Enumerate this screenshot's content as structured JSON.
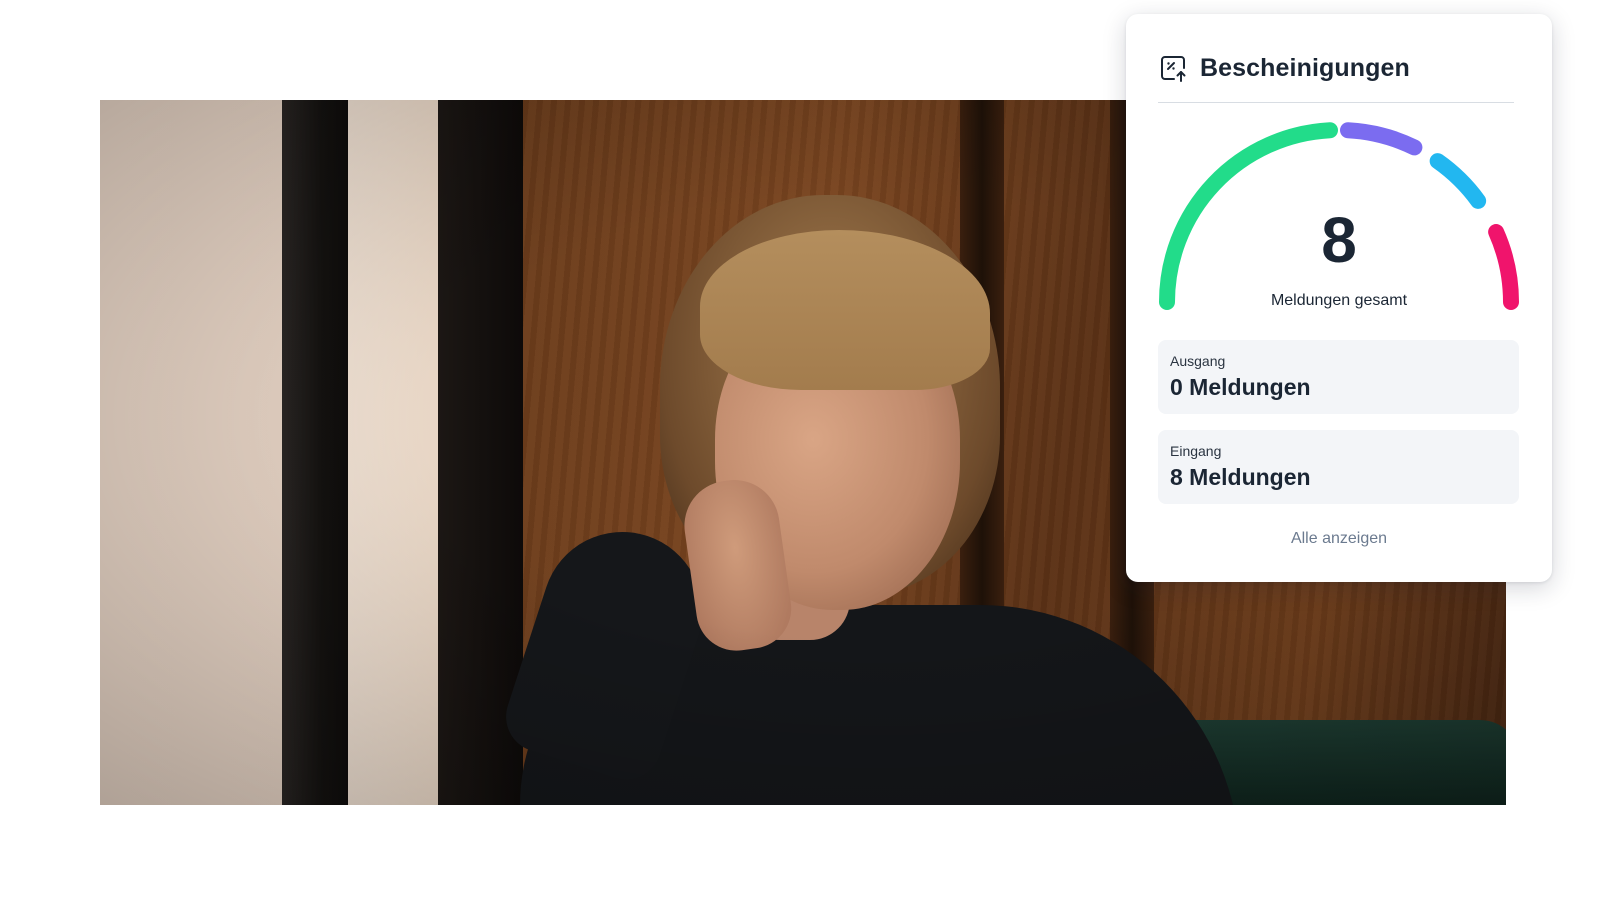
{
  "widget": {
    "title": "Bescheinigungen",
    "icon": "certificate-upload-icon",
    "gauge": {
      "total_value": "8",
      "total_label": "Meldungen gesamt",
      "segments": [
        {
          "color": "#22dc8a"
        },
        {
          "color": "#7b6cf0"
        },
        {
          "color": "#22b7f0"
        },
        {
          "color": "#f0146c"
        }
      ]
    },
    "outgoing": {
      "label": "Ausgang",
      "value": "0 Meldungen"
    },
    "incoming": {
      "label": "Eingang",
      "value": "8 Meldungen"
    },
    "show_all_label": "Alle anzeigen"
  },
  "colors": {
    "text_primary": "#1b2634",
    "text_link": "#6b7a8f",
    "stat_background": "#f3f5f8"
  }
}
